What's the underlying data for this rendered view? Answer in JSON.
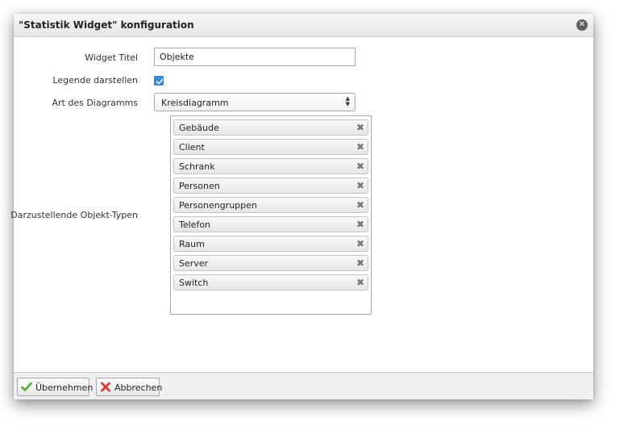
{
  "dialog": {
    "title": "\"Statistik Widget\" konfiguration",
    "close_symbol": "✕"
  },
  "form": {
    "widget_title": {
      "label": "Widget Titel",
      "value": "Objekte"
    },
    "legend": {
      "label": "Legende darstellen",
      "checked": true
    },
    "chart_type": {
      "label": "Art des Diagramms",
      "value": "Kreisdiagramm"
    },
    "object_types": {
      "label": "Darzustellende Objekt-Typen",
      "items": [
        "Gebäude",
        "Client",
        "Schrank",
        "Personen",
        "Personengruppen",
        "Telefon",
        "Raum",
        "Server",
        "Switch"
      ],
      "remove_symbol": "✖"
    }
  },
  "footer": {
    "apply_label": "Übernehmen",
    "cancel_label": "Abbrechen"
  },
  "icons": {
    "close": "close-icon",
    "check": "check-icon",
    "apply": "checkmark-icon",
    "cancel": "red-x-icon",
    "remove": "remove-x-icon"
  },
  "colors": {
    "checkbox": "#3a8ee6",
    "apply_icon": "#4caf2e",
    "cancel_icon": "#e03a2f"
  }
}
